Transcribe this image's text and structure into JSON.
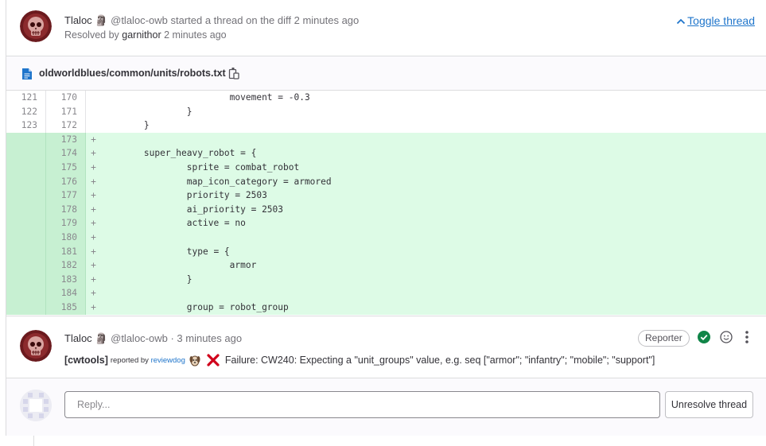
{
  "thread": {
    "author": "Tlaloc",
    "author_emoji": "🗿",
    "header_text": "@tlaloc-owb started a thread on the diff 2 minutes ago",
    "resolved_prefix": "Resolved by",
    "resolver": "garnithor",
    "resolved_time": "2 minutes ago",
    "toggle_label": "Toggle thread"
  },
  "file": {
    "path": "oldworldblues/common/units/robots.txt"
  },
  "diff": {
    "lines": [
      {
        "old": "121",
        "new": "170",
        "sign": "",
        "code": "                        movement = -0.3",
        "type": "context"
      },
      {
        "old": "122",
        "new": "171",
        "sign": "",
        "code": "                }",
        "type": "context"
      },
      {
        "old": "123",
        "new": "172",
        "sign": "",
        "code": "        }",
        "type": "context"
      },
      {
        "old": "",
        "new": "173",
        "sign": "+",
        "code": "",
        "type": "add"
      },
      {
        "old": "",
        "new": "174",
        "sign": "+",
        "code": "        super_heavy_robot = {",
        "type": "add"
      },
      {
        "old": "",
        "new": "175",
        "sign": "+",
        "code": "                sprite = combat_robot",
        "type": "add"
      },
      {
        "old": "",
        "new": "176",
        "sign": "+",
        "code": "                map_icon_category = armored",
        "type": "add"
      },
      {
        "old": "",
        "new": "177",
        "sign": "+",
        "code": "                priority = 2503",
        "type": "add"
      },
      {
        "old": "",
        "new": "178",
        "sign": "+",
        "code": "                ai_priority = 2503",
        "type": "add"
      },
      {
        "old": "",
        "new": "179",
        "sign": "+",
        "code": "                active = no",
        "type": "add"
      },
      {
        "old": "",
        "new": "180",
        "sign": "+",
        "code": "",
        "type": "add"
      },
      {
        "old": "",
        "new": "181",
        "sign": "+",
        "code": "                type = {",
        "type": "add"
      },
      {
        "old": "",
        "new": "182",
        "sign": "+",
        "code": "                        armor",
        "type": "add"
      },
      {
        "old": "",
        "new": "183",
        "sign": "+",
        "code": "                }",
        "type": "add"
      },
      {
        "old": "",
        "new": "184",
        "sign": "+",
        "code": "",
        "type": "add"
      },
      {
        "old": "",
        "new": "185",
        "sign": "+",
        "code": "                group = robot_group",
        "type": "add"
      }
    ]
  },
  "note": {
    "author": "Tlaloc",
    "author_emoji": "🗿",
    "meta": "@tlaloc-owb · 3 minutes ago",
    "role_badge": "Reporter",
    "tag": "[cwtools]",
    "reported_by": "reported by",
    "reporter_link": "reviewdog",
    "message": "Failure: CW240: Expecting a \"unit_groups\" value, e.g. seq [\"armor\"; \"infantry\"; \"mobile\"; \"support\"]"
  },
  "reply": {
    "placeholder": "Reply...",
    "unresolve_label": "Unresolve thread"
  },
  "colors": {
    "link": "#1f75cb",
    "added_bg": "#ddfbe6",
    "added_gutter": "#c7f0d2",
    "resolved_green": "#108548",
    "error_red": "#d0021b"
  },
  "icons": [
    "skull-avatar-icon",
    "chevron-up-icon",
    "file-icon",
    "copy-icon",
    "check-circle-icon",
    "smiley-icon",
    "more-vertical-icon",
    "dog-icon",
    "cross-mark-icon"
  ]
}
